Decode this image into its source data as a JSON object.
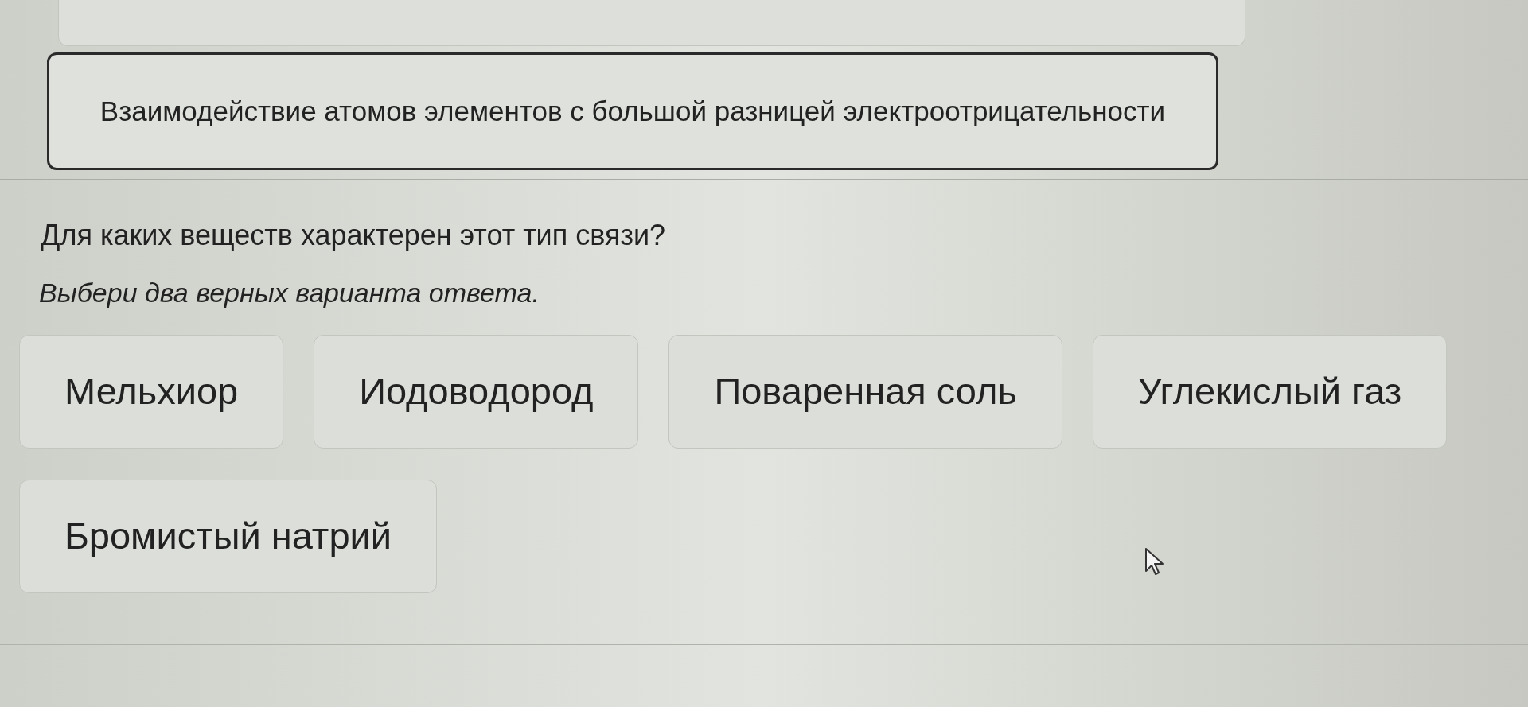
{
  "definition_cards": [
    {
      "selected": false
    },
    {
      "text": "Взаимодействие атомов элементов с большой разницей электроотрицательности",
      "selected": true
    }
  ],
  "question": "Для каких веществ характерен этот тип связи?",
  "instruction": "Выбери два верных варианта ответа.",
  "options": [
    {
      "label": "Мельхиор",
      "selected": false
    },
    {
      "label": "Иодоводород",
      "selected": false
    },
    {
      "label": "Поваренная соль",
      "selected": false
    },
    {
      "label": "Углекислый газ",
      "selected": false
    },
    {
      "label": "Бромистый натрий",
      "selected": false
    }
  ]
}
